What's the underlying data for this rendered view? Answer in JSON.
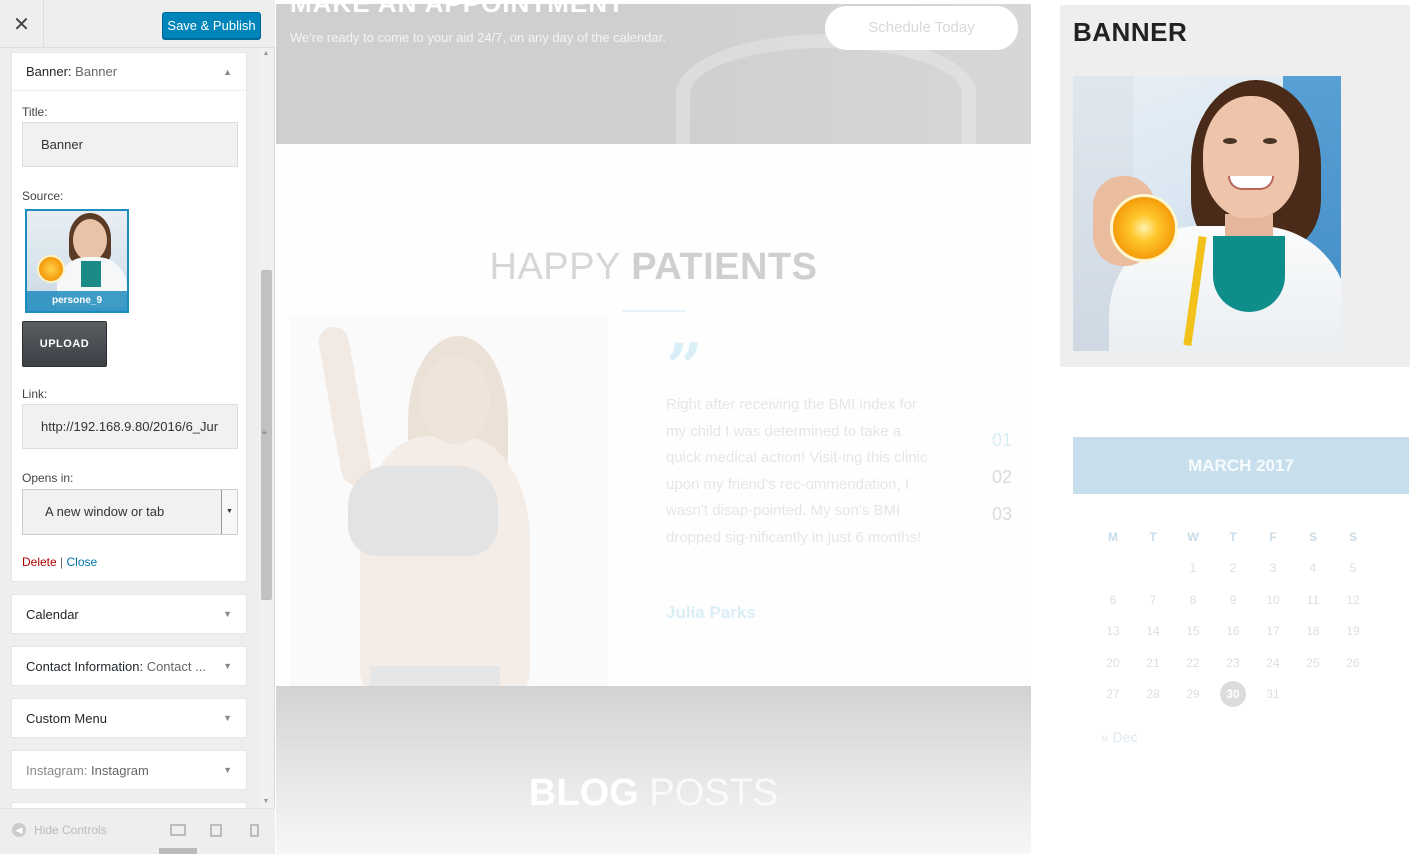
{
  "header": {
    "close_icon": "close-icon",
    "publish_label": "Save & Publish"
  },
  "banner_widget": {
    "type_label": "Banner:",
    "title_label": "Banner",
    "fields": {
      "title_label": "Title:",
      "title_value": "Banner",
      "source_label": "Source:",
      "source_caption": "persone_9",
      "upload_label": "UPLOAD",
      "link_label": "Link:",
      "link_value": "http://192.168.9.80/2016/6_Jur",
      "opens_label": "Opens in:",
      "opens_value": "A new window or tab"
    },
    "delete_label": "Delete",
    "separator": "|",
    "close_label": "Close"
  },
  "other_widgets": [
    {
      "type": "Calendar",
      "title": ""
    },
    {
      "type": "Contact Information:",
      "title": "Contact ..."
    },
    {
      "type": "Custom Menu",
      "title": ""
    },
    {
      "type": "Instagram:",
      "title": "Instagram"
    }
  ],
  "footer": {
    "hide_controls_label": "Hide Controls"
  },
  "preview": {
    "appointment": {
      "title": "MAKE AN APPOINTMENT",
      "subtitle": "We're ready to come to your aid 24/7, on any day of the calendar.",
      "button": "Schedule Today"
    },
    "patients": {
      "title_light": "HAPPY",
      "title_bold": "PATIENTS",
      "quote_mark": "”",
      "quote": "Right after receiving the BMI index for my child I was determined to take a quick medical action! Visit-ing this clinic upon my friend's rec-ommendation, I wasn't disap-pointed. My son's BMI dropped sig-nificantly in just 6 months!",
      "author": "Julia Parks",
      "slides": [
        "01",
        "02",
        "03"
      ]
    },
    "blog": {
      "title_bold": "BLOG",
      "title_light": "POSTS"
    }
  },
  "sidebar": {
    "banner_heading": "BANNER",
    "calendar": {
      "caption": "MARCH 2017",
      "weekdays": [
        "M",
        "T",
        "W",
        "T",
        "F",
        "S",
        "S"
      ],
      "weeks": [
        [
          "",
          "",
          "1",
          "2",
          "3",
          "4",
          "5"
        ],
        [
          "6",
          "7",
          "8",
          "9",
          "10",
          "11",
          "12"
        ],
        [
          "13",
          "14",
          "15",
          "16",
          "17",
          "18",
          "19"
        ],
        [
          "20",
          "21",
          "22",
          "23",
          "24",
          "25",
          "26"
        ],
        [
          "27",
          "28",
          "29",
          "30",
          "31",
          "",
          ""
        ]
      ],
      "today": "30",
      "prev_link": "« Dec"
    }
  },
  "colors": {
    "publish_blue": "#0085ba",
    "delete_red": "#aa0000",
    "link_blue": "#0073aa",
    "calendar_caption": "#c7dfed"
  }
}
